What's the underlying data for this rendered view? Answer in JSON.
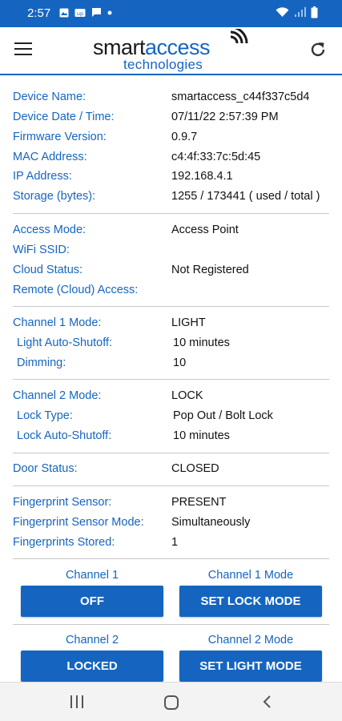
{
  "status_bar": {
    "time": "2:57",
    "left_icons": [
      "image-icon",
      "vpn-key-icon",
      "message-icon",
      "dot-icon"
    ],
    "right_icons": [
      "wifi-icon",
      "signal-icon",
      "battery-icon"
    ]
  },
  "header": {
    "logo_smart": "smart",
    "logo_access": "access",
    "logo_sub": "technologies"
  },
  "device_info": [
    {
      "label": "Device Name:",
      "value": "smartaccess_c44f337c5d4"
    },
    {
      "label": "Device Date / Time:",
      "value": "07/11/22 2:57:39 PM"
    },
    {
      "label": "Firmware Version:",
      "value": "0.9.7"
    },
    {
      "label": "MAC Address:",
      "value": "c4:4f:33:7c:5d:45"
    },
    {
      "label": "IP Address:",
      "value": "192.168.4.1"
    },
    {
      "label": "Storage (bytes):",
      "value": "1255 / 173441 ( used / total )"
    }
  ],
  "access_info": [
    {
      "label": "Access Mode:",
      "value": "Access Point"
    },
    {
      "label": "WiFi SSID:",
      "value": ""
    },
    {
      "label": "Cloud Status:",
      "value": "Not Registered"
    },
    {
      "label": "Remote (Cloud) Access:",
      "value": ""
    }
  ],
  "channel1": [
    {
      "label": "Channel 1 Mode:",
      "value": "LIGHT"
    },
    {
      "label": "Light Auto-Shutoff:",
      "value": "10 minutes"
    },
    {
      "label": "Dimming:",
      "value": "10"
    }
  ],
  "channel2": [
    {
      "label": "Channel 2 Mode:",
      "value": "LOCK"
    },
    {
      "label": "Lock Type:",
      "value": "Pop Out / Bolt Lock"
    },
    {
      "label": "Lock Auto-Shutoff:",
      "value": "10 minutes"
    }
  ],
  "door": {
    "label": "Door Status:",
    "value": "CLOSED"
  },
  "fingerprint": [
    {
      "label": "Fingerprint Sensor:",
      "value": "PRESENT"
    },
    {
      "label": "Fingerprint Sensor Mode:",
      "value": "Simultaneously"
    },
    {
      "label": "Fingerprints Stored:",
      "value": "1"
    }
  ],
  "controls": {
    "ch1_label": "Channel 1",
    "ch1_button": "OFF",
    "ch1_mode_label": "Channel 1 Mode",
    "ch1_mode_button": "SET LOCK MODE",
    "ch2_label": "Channel 2",
    "ch2_button": "LOCKED",
    "ch2_mode_label": "Channel 2 Mode",
    "ch2_mode_button": "SET LIGHT MODE"
  },
  "colors": {
    "brand_blue": "#1565c0",
    "text": "#111111",
    "divider": "#c8c8c8"
  }
}
